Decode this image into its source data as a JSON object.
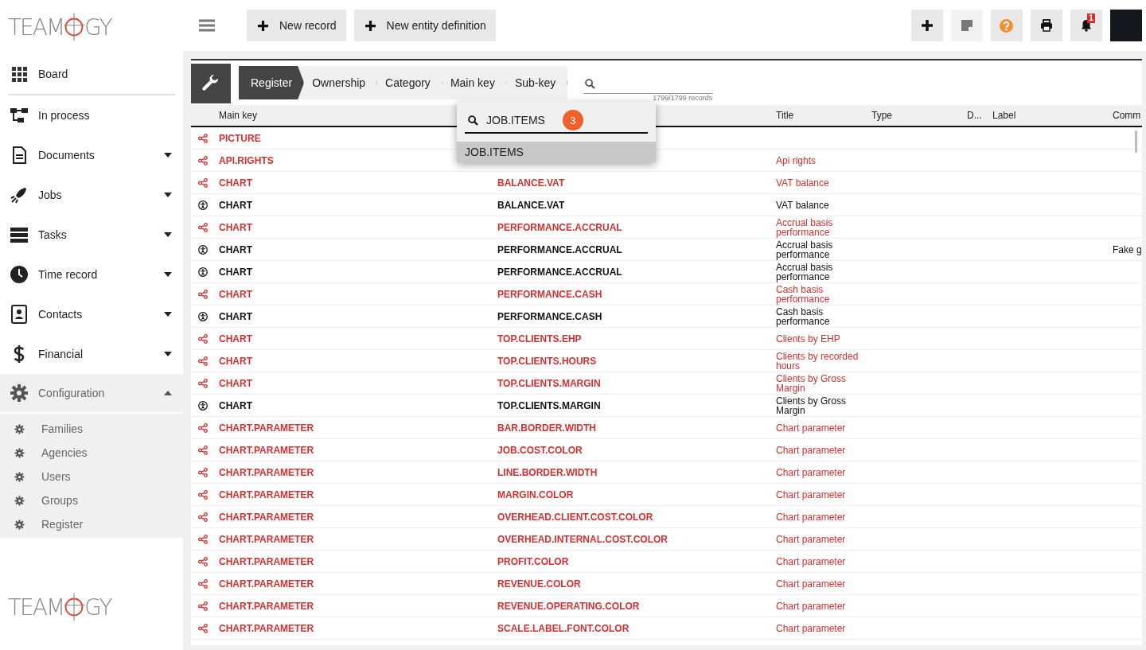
{
  "logo": {
    "left": "TEAM",
    "right": "GY"
  },
  "sidebar": {
    "items": [
      {
        "label": "Board",
        "kind": "link"
      },
      {
        "label": "In process",
        "kind": "link"
      },
      {
        "label": "Documents",
        "kind": "group",
        "expanded": false
      },
      {
        "label": "Jobs",
        "kind": "group",
        "expanded": false
      },
      {
        "label": "Tasks",
        "kind": "group",
        "expanded": false
      },
      {
        "label": "Time record",
        "kind": "group",
        "expanded": false
      },
      {
        "label": "Contacts",
        "kind": "group",
        "expanded": false
      },
      {
        "label": "Financial",
        "kind": "group",
        "expanded": false
      },
      {
        "label": "Configuration",
        "kind": "group",
        "expanded": true,
        "children": [
          {
            "label": "Families"
          },
          {
            "label": "Agencies"
          },
          {
            "label": "Users"
          },
          {
            "label": "Groups"
          },
          {
            "label": "Register"
          }
        ]
      }
    ]
  },
  "footer_logo": {
    "left": "TEAM",
    "right": "GY"
  },
  "toolbar": {
    "buttons": [
      {
        "label": "New record"
      },
      {
        "label": "New entity definition"
      }
    ],
    "actions": [
      {
        "kind": "add",
        "disabled": false
      },
      {
        "kind": "note",
        "disabled": true
      },
      {
        "kind": "help",
        "disabled": false
      },
      {
        "kind": "print",
        "disabled": false
      },
      {
        "kind": "notifications",
        "disabled": false,
        "badge": "1"
      }
    ]
  },
  "breadcrumb": [
    {
      "label": "Register",
      "selected": true
    },
    {
      "label": "Ownership",
      "selected": false
    },
    {
      "label": "Category",
      "selected": false
    },
    {
      "label": "Main key",
      "selected": false
    },
    {
      "label": "Sub-key",
      "selected": false
    }
  ],
  "search": {
    "count": "1799/1799 records"
  },
  "dropdown": {
    "value": "JOB.ITEMS",
    "badge": "3",
    "options": [
      {
        "label": "JOB.ITEMS",
        "selected": true
      }
    ]
  },
  "table": {
    "columns": [
      "Main key",
      "Title",
      "Type",
      "D...",
      "Label",
      "Comm"
    ],
    "rows": [
      {
        "kind": "shared",
        "main_key": "PICTURE",
        "sub_key": "",
        "title": ""
      },
      {
        "kind": "shared",
        "main_key": "API.RIGHTS",
        "sub_key": "",
        "title": "Api rights"
      },
      {
        "kind": "shared",
        "main_key": "CHART",
        "sub_key": "BALANCE.VAT",
        "title": "VAT balance"
      },
      {
        "kind": "system",
        "main_key": "CHART",
        "sub_key": "BALANCE.VAT",
        "title": "VAT balance"
      },
      {
        "kind": "shared",
        "main_key": "CHART",
        "sub_key": "PERFORMANCE.ACCRUAL",
        "title": "Accrual basis performance"
      },
      {
        "kind": "system",
        "main_key": "CHART",
        "sub_key": "PERFORMANCE.ACCRUAL",
        "title": "Accrual basis performance",
        "comment": "Fake g"
      },
      {
        "kind": "system",
        "main_key": "CHART",
        "sub_key": "PERFORMANCE.ACCRUAL",
        "title": "Accrual basis performance"
      },
      {
        "kind": "shared",
        "main_key": "CHART",
        "sub_key": "PERFORMANCE.CASH",
        "title": "Cash basis performance"
      },
      {
        "kind": "system",
        "main_key": "CHART",
        "sub_key": "PERFORMANCE.CASH",
        "title": "Cash basis performance"
      },
      {
        "kind": "shared",
        "main_key": "CHART",
        "sub_key": "TOP.CLIENTS.EHP",
        "title": "Clients by EHP"
      },
      {
        "kind": "shared",
        "main_key": "CHART",
        "sub_key": "TOP.CLIENTS.HOURS",
        "title": "Clients by recorded hours"
      },
      {
        "kind": "shared",
        "main_key": "CHART",
        "sub_key": "TOP.CLIENTS.MARGIN",
        "title": "Clients by Gross Margin"
      },
      {
        "kind": "system",
        "main_key": "CHART",
        "sub_key": "TOP.CLIENTS.MARGIN",
        "title": "Clients by Gross Margin"
      },
      {
        "kind": "shared",
        "main_key": "CHART.PARAMETER",
        "sub_key": "BAR.BORDER.WIDTH",
        "title": "Chart parameter"
      },
      {
        "kind": "shared",
        "main_key": "CHART.PARAMETER",
        "sub_key": "JOB.COST.COLOR",
        "title": "Chart parameter"
      },
      {
        "kind": "shared",
        "main_key": "CHART.PARAMETER",
        "sub_key": "LINE.BORDER.WIDTH",
        "title": "Chart parameter"
      },
      {
        "kind": "shared",
        "main_key": "CHART.PARAMETER",
        "sub_key": "MARGIN.COLOR",
        "title": "Chart parameter"
      },
      {
        "kind": "shared",
        "main_key": "CHART.PARAMETER",
        "sub_key": "OVERHEAD.CLIENT.COST.COLOR",
        "title": "Chart parameter"
      },
      {
        "kind": "shared",
        "main_key": "CHART.PARAMETER",
        "sub_key": "OVERHEAD.INTERNAL.COST.COLOR",
        "title": "Chart parameter"
      },
      {
        "kind": "shared",
        "main_key": "CHART.PARAMETER",
        "sub_key": "PROFIT.COLOR",
        "title": "Chart parameter"
      },
      {
        "kind": "shared",
        "main_key": "CHART.PARAMETER",
        "sub_key": "REVENUE.COLOR",
        "title": "Chart parameter"
      },
      {
        "kind": "shared",
        "main_key": "CHART.PARAMETER",
        "sub_key": "REVENUE.OPERATING.COLOR",
        "title": "Chart parameter"
      },
      {
        "kind": "shared",
        "main_key": "CHART.PARAMETER",
        "sub_key": "SCALE.LABEL.FONT.COLOR",
        "title": "Chart parameter"
      }
    ]
  }
}
